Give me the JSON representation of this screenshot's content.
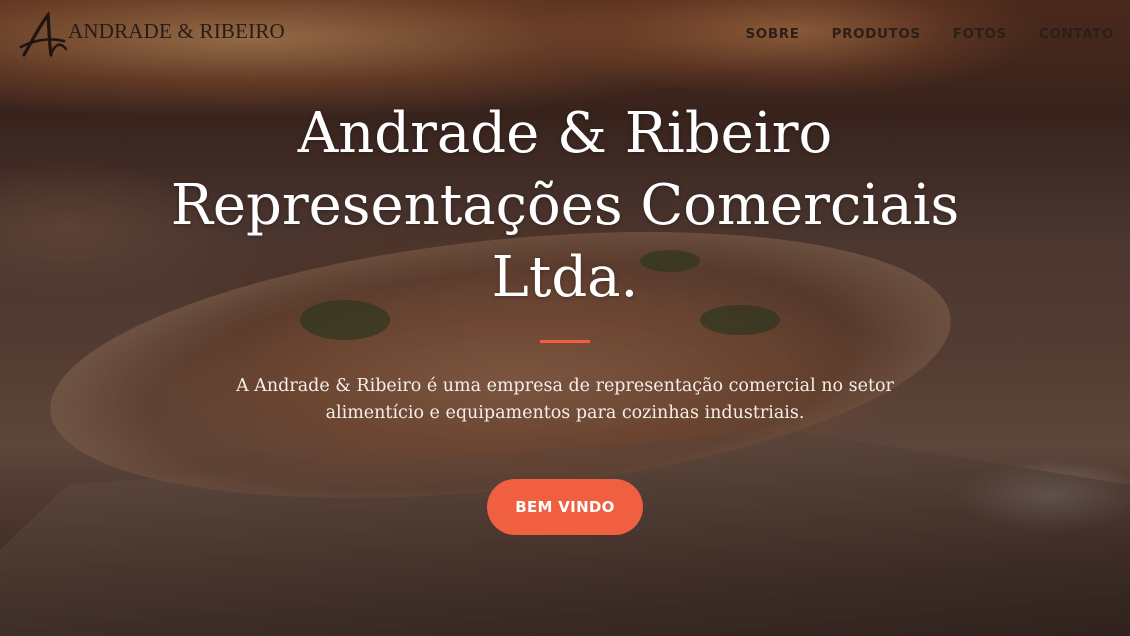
{
  "navbar": {
    "brand_text": "ANDRADE & RIBEIRO",
    "brand_logo_icon": "ar-monogram-logo",
    "links": [
      {
        "label": "SOBRE"
      },
      {
        "label": "PRODUTOS"
      },
      {
        "label": "FOTOS"
      },
      {
        "label": "CONTATO"
      }
    ]
  },
  "hero": {
    "title_line1": "Andrade & Ribeiro",
    "title_line2": "Representações Comerciais",
    "title_line3": "Ltda.",
    "lead": "A Andrade & Ribeiro é uma empresa de representação comercial no setor alimentício e equipamentos para cozinhas industriais.",
    "button_label": "BEM VINDO"
  },
  "colors": {
    "accent": "#f05f40",
    "nav_text": "#2c1e18",
    "hero_text": "#ffffff"
  }
}
